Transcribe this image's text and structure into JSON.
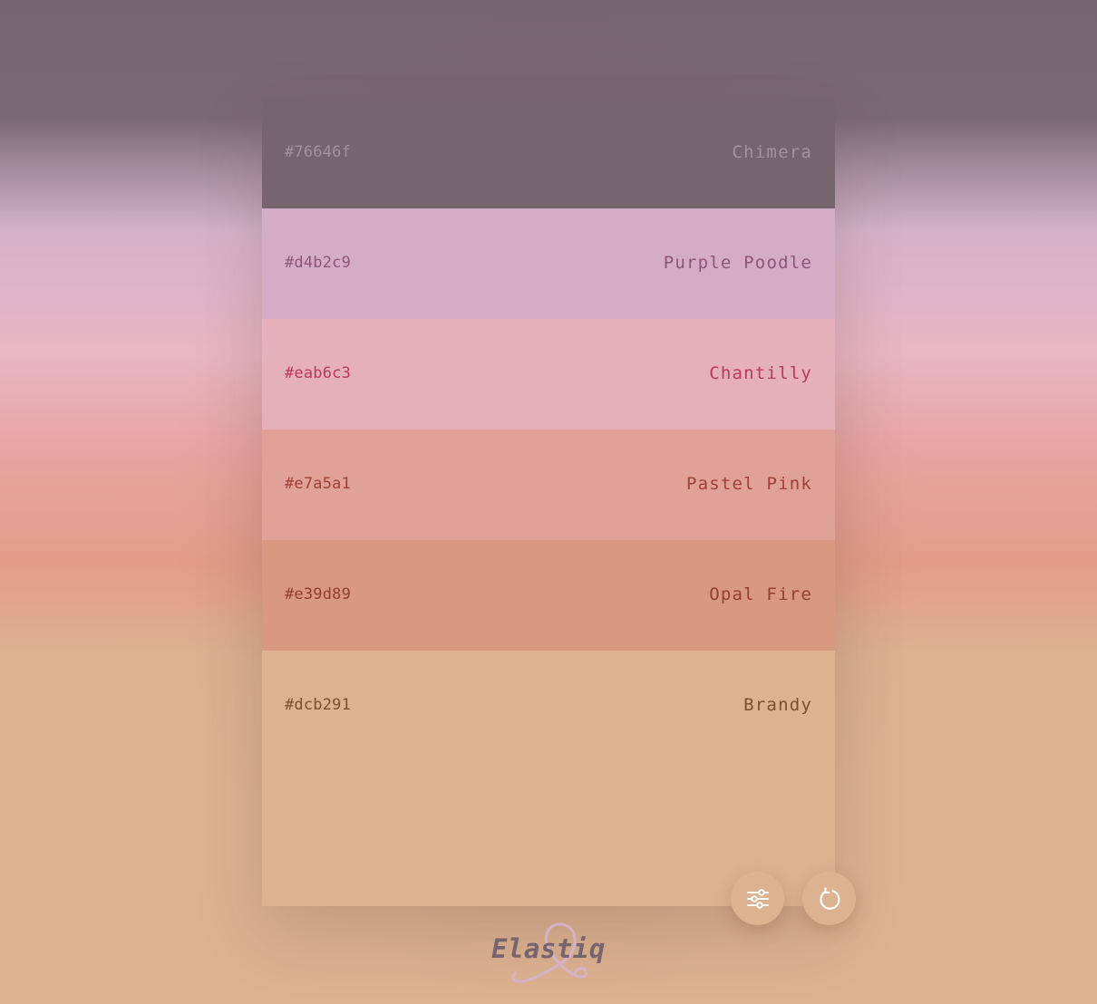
{
  "swatches": [
    {
      "hex": "#76646f",
      "name": "Chimera",
      "bg": "#76646f",
      "fg": "#a4929c"
    },
    {
      "hex": "#d4b2c9",
      "name": "Purple Poodle",
      "bg": "#d4acc6",
      "fg": "#8e5578"
    },
    {
      "hex": "#eab6c3",
      "name": "Chantilly",
      "bg": "#e6b0bb",
      "fg": "#b8395a"
    },
    {
      "hex": "#e7a5a1",
      "name": "Pastel Pink",
      "bg": "#e0a198",
      "fg": "#a23f36"
    },
    {
      "hex": "#e39d89",
      "name": "Opal Fire",
      "bg": "#d99880",
      "fg": "#92402d"
    },
    {
      "hex": "#dcb291",
      "name": "Brandy",
      "bg": "#dcb291",
      "fg": "#7e4f2e"
    }
  ],
  "controls": {
    "settings_icon": "sliders-icon",
    "refresh_icon": "refresh-icon"
  },
  "logo": {
    "text": "Elastiq",
    "text_color": "#76646f",
    "loop_color": "#d4b2c9"
  }
}
